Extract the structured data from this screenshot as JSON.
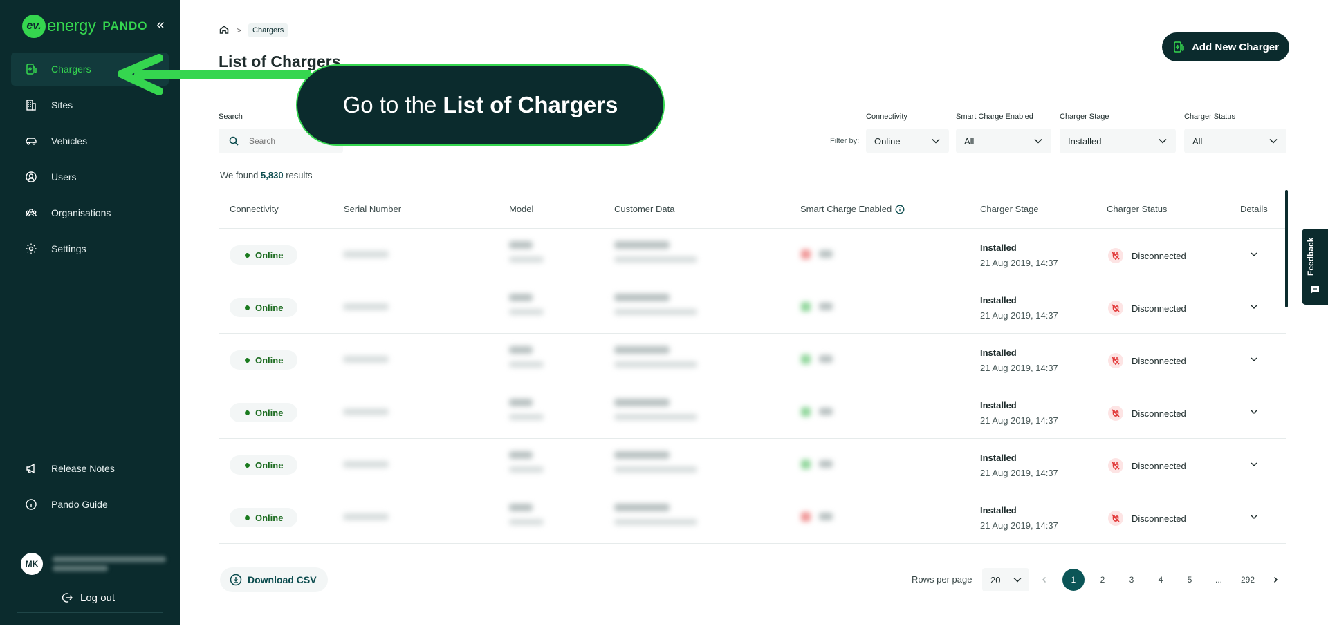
{
  "brand": {
    "logo_text": "ev.",
    "energy": "energy",
    "product": "PANDO"
  },
  "sidebar": {
    "collapse_glyph": "«",
    "items": [
      {
        "label": "Chargers",
        "icon": "charger-icon",
        "active": true
      },
      {
        "label": "Sites",
        "icon": "building-icon"
      },
      {
        "label": "Vehicles",
        "icon": "car-icon"
      },
      {
        "label": "Users",
        "icon": "user-icon"
      },
      {
        "label": "Organisations",
        "icon": "organisation-icon"
      },
      {
        "label": "Settings",
        "icon": "gear-icon"
      }
    ],
    "bottom_items": [
      {
        "label": "Release Notes",
        "icon": "megaphone-icon"
      },
      {
        "label": "Pando Guide",
        "icon": "info-icon"
      }
    ],
    "user_initials": "MK",
    "logout_label": "Log out"
  },
  "breadcrumb": {
    "current": "Chargers",
    "sep": ">"
  },
  "page": {
    "title": "List of Chargers",
    "add_button": "Add New Charger"
  },
  "filters": {
    "search_label": "Search",
    "search_placeholder": "Search",
    "filter_by": "Filter by:",
    "connectivity": {
      "label": "Connectivity",
      "value": "Online"
    },
    "smart_charge": {
      "label": "Smart Charge Enabled",
      "value": "All"
    },
    "charger_stage": {
      "label": "Charger Stage",
      "value": "Installed"
    },
    "charger_status": {
      "label": "Charger Status",
      "value": "All"
    }
  },
  "results": {
    "prefix": "We found",
    "count": "5,830",
    "suffix": "results"
  },
  "table": {
    "headers": [
      "Connectivity",
      "Serial Number",
      "Model",
      "Customer Data",
      "Smart Charge Enabled",
      "Charger Stage",
      "Charger Status",
      "Details"
    ],
    "rows": [
      {
        "connectivity": "Online",
        "stage": "Installed",
        "date": "21 Aug 2019, 14:37",
        "status": "Disconnected",
        "smart": "red"
      },
      {
        "connectivity": "Online",
        "stage": "Installed",
        "date": "21 Aug 2019, 14:37",
        "status": "Disconnected",
        "smart": "green"
      },
      {
        "connectivity": "Online",
        "stage": "Installed",
        "date": "21 Aug 2019, 14:37",
        "status": "Disconnected",
        "smart": "green"
      },
      {
        "connectivity": "Online",
        "stage": "Installed",
        "date": "21 Aug 2019, 14:37",
        "status": "Disconnected",
        "smart": "green"
      },
      {
        "connectivity": "Online",
        "stage": "Installed",
        "date": "21 Aug 2019, 14:37",
        "status": "Disconnected",
        "smart": "green"
      },
      {
        "connectivity": "Online",
        "stage": "Installed",
        "date": "21 Aug 2019, 14:37",
        "status": "Disconnected",
        "smart": "red"
      }
    ]
  },
  "footer": {
    "download_csv": "Download CSV",
    "rows_per_page_label": "Rows per page",
    "rows_per_page": "20",
    "pages": [
      "1",
      "2",
      "3",
      "4",
      "5",
      "...",
      "292"
    ],
    "current_page": "1"
  },
  "feedback_label": "Feedback",
  "callout": {
    "prefix": "Go to the",
    "bold": "List of Chargers"
  },
  "colors": {
    "sidebar_bg": "#0b2b2d",
    "accent": "#35d64f",
    "online": "#1b6b1f",
    "disconnected": "#e23b3b"
  }
}
